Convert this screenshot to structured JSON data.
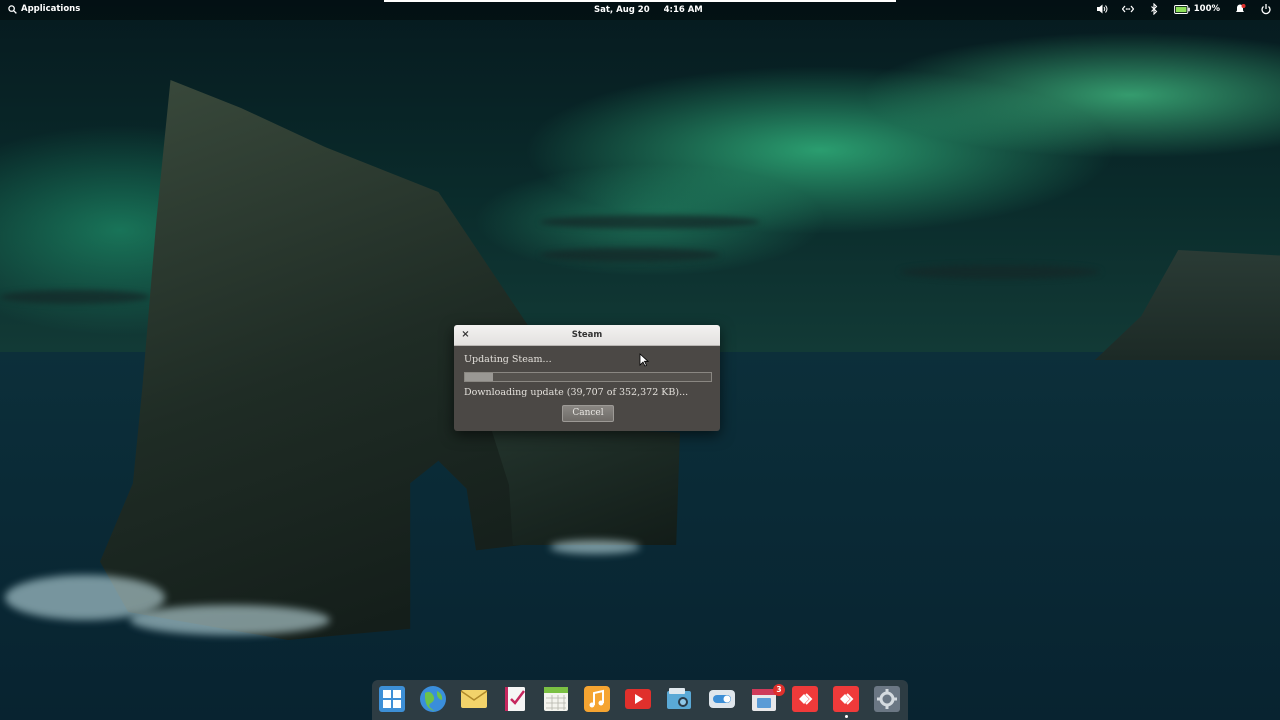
{
  "panel": {
    "applications_label": "Applications",
    "date": "Sat, Aug 20",
    "time": "4:16 AM",
    "battery_percent": "100%"
  },
  "dialog": {
    "title": "Steam",
    "close_glyph": "×",
    "status": "Updating Steam...",
    "progress_fraction": 0.113,
    "detail": "Downloading update (39,707 of 352,372 KB)...",
    "cancel_label": "Cancel"
  },
  "dock": {
    "apps": [
      {
        "name": "multitasking-view-icon"
      },
      {
        "name": "web-browser-icon"
      },
      {
        "name": "mail-icon"
      },
      {
        "name": "tasks-icon"
      },
      {
        "name": "calendar-icon"
      },
      {
        "name": "music-icon"
      },
      {
        "name": "videos-icon"
      },
      {
        "name": "photos-icon"
      },
      {
        "name": "switchboard-toggle-icon"
      },
      {
        "name": "appcenter-icon",
        "badge": "3"
      },
      {
        "name": "anydesk-icon"
      },
      {
        "name": "anydesk-icon"
      },
      {
        "name": "system-settings-icon"
      }
    ]
  },
  "colors": {
    "dialog_bg": "#4b4845",
    "progress_fill": "#9a9894",
    "battery": "#8ee05a",
    "aurora": "#46ffaa"
  }
}
